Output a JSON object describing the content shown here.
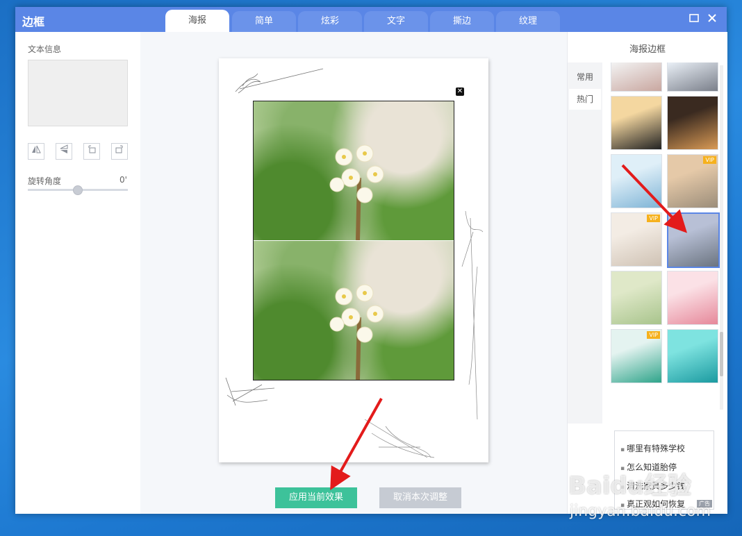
{
  "titlebar": {
    "app_title": "边框",
    "tabs": [
      "海报",
      "简单",
      "炫彩",
      "文字",
      "撕边",
      "纹理"
    ],
    "active_tab": "海报",
    "maximize_icon": "maximize-icon",
    "close_icon": "close-icon"
  },
  "left_panel": {
    "text_info_label": "文本信息",
    "tools": [
      "flip-horizontal-icon",
      "flip-vertical-icon",
      "rotate-left-icon",
      "rotate-right-icon"
    ],
    "rotate_label": "旋转角度",
    "rotate_value": "0'",
    "rotate_slider_level": 0.5
  },
  "canvas": {
    "remove_icon": "close-small-icon",
    "apply_button": "应用当前效果",
    "cancel_button": "取消本次调整"
  },
  "right_panel": {
    "title": "海报边框",
    "categories": [
      "常用",
      "热门"
    ],
    "active_category": "常用",
    "thumbnails": [
      {
        "vip": "",
        "colors": [
          "#f2f2f2",
          "#c9a7a0"
        ]
      },
      {
        "vip": "",
        "colors": [
          "#e8eef5",
          "#7a7f8a"
        ]
      },
      {
        "vip": "",
        "colors": [
          "#f4d7a0",
          "#222222"
        ]
      },
      {
        "vip": "",
        "colors": [
          "#3a2a20",
          "#d99a55"
        ]
      },
      {
        "vip": "",
        "colors": [
          "#dfeff8",
          "#7fb4d6"
        ]
      },
      {
        "vip": "VIP",
        "colors": [
          "#e5c9a8",
          "#9b8d7a"
        ]
      },
      {
        "vip": "VIP",
        "colors": [
          "#f3ece4",
          "#cfc2b4"
        ]
      },
      {
        "vip": "",
        "colors": [
          "#b8c0d6",
          "#6b7480"
        ]
      },
      {
        "vip": "",
        "colors": [
          "#dfe8c8",
          "#a8c48c"
        ]
      },
      {
        "vip": "",
        "colors": [
          "#fbe1e6",
          "#e6889a"
        ]
      },
      {
        "vip": "VIP",
        "colors": [
          "#e4f3f0",
          "#2fa48a"
        ]
      },
      {
        "vip": "",
        "colors": [
          "#7ee3e0",
          "#1b9aa0"
        ]
      }
    ],
    "selected_index": 7,
    "ads": [
      "哪里有特殊学校",
      "怎么知道胎停",
      "清洗家具多少钱",
      "真正观如何恢复"
    ],
    "ad_tag": "广告"
  },
  "watermark": {
    "brand": "Baidu经验",
    "url": "jingyan.baidu.com"
  },
  "colors": {
    "accent": "#5a86e6",
    "apply": "#3dc29a",
    "cancel": "#c6cbd3",
    "vip": "#f6b11c",
    "arrow": "#e31b1b"
  }
}
